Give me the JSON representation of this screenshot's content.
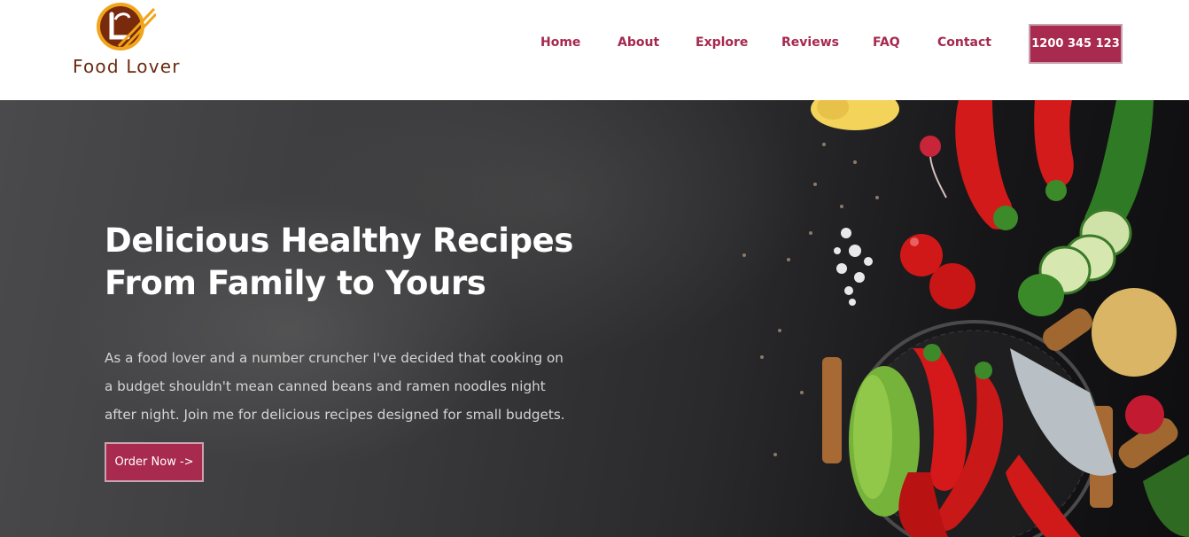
{
  "brand": {
    "name": "Food Lover",
    "logo_icon": "chopsticks-plate-logo"
  },
  "nav": {
    "items": [
      {
        "label": "Home"
      },
      {
        "label": "About"
      },
      {
        "label": "Explore"
      },
      {
        "label": "Reviews"
      },
      {
        "label": "FAQ"
      },
      {
        "label": "Contact"
      }
    ],
    "phone": "1200 345 123"
  },
  "hero": {
    "title_lines": [
      "Delicious Healthy Recipes",
      "From Family to Yours"
    ],
    "description_lines": [
      "As a food lover and a number cruncher I've decided that cooking on",
      "a budget shouldn't mean canned beans and ramen noodles night",
      "after night. Join me for delicious recipes designed for small budgets."
    ],
    "cta_label": "Order Now ->"
  },
  "colors": {
    "accent": "#a82a4e",
    "nav_text": "#a6284f",
    "logo_text": "#6b2a10"
  }
}
